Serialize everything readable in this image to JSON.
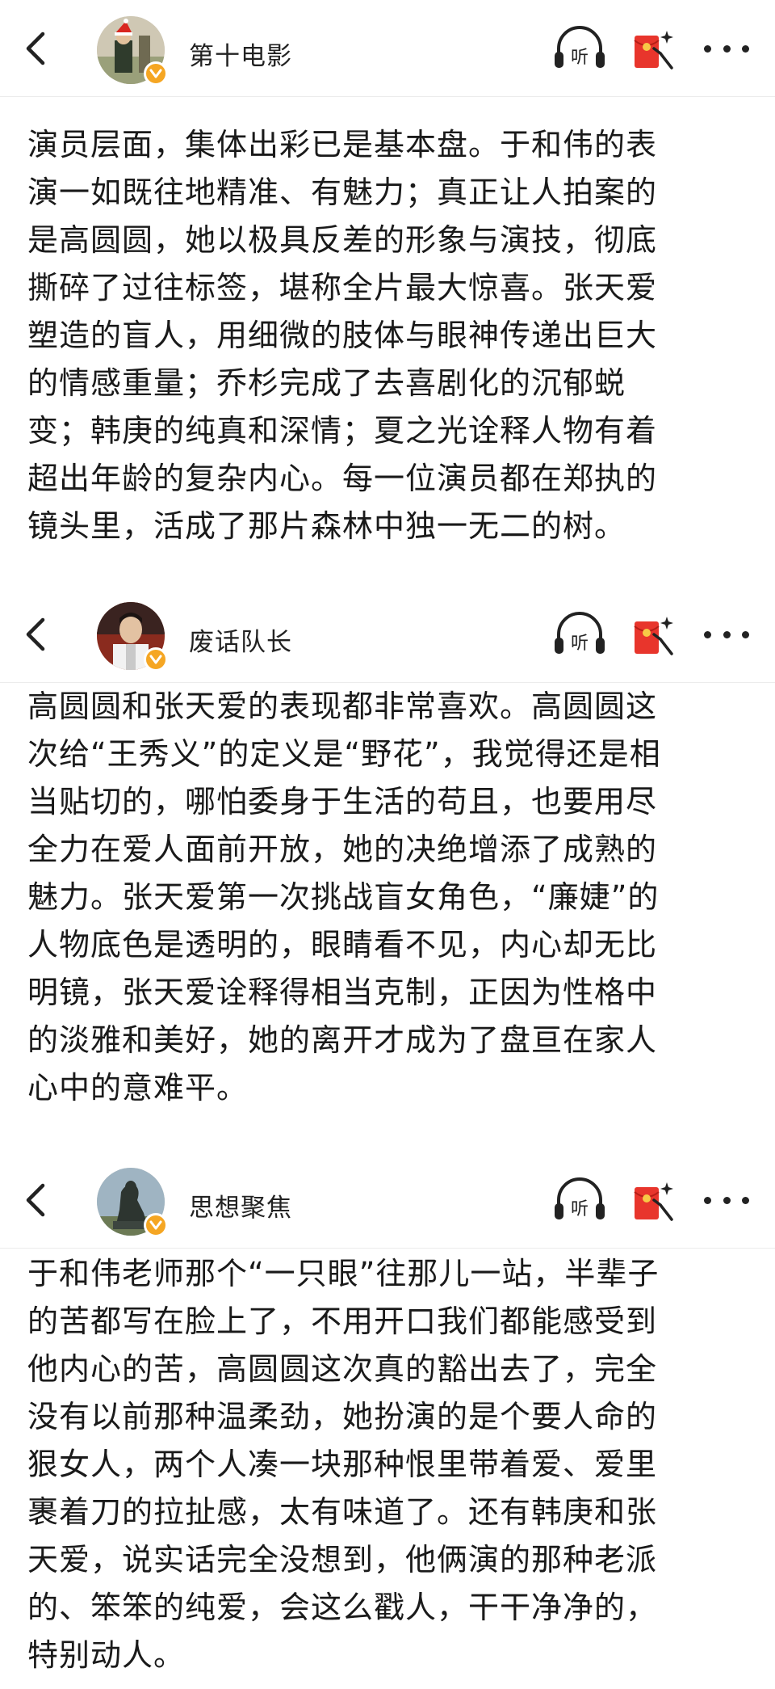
{
  "posts": [
    {
      "username": "第十电影",
      "avatar": "avatar-santa-hat",
      "lines": [
        "演员层面，集体出彩已是基本盘。于和伟的表",
        "演一如既往地精准、有魅力；真正让人拍案的",
        "是高圆圆，她以极具反差的形象与演技，彻底",
        "撕碎了过往标签，堪称全片最大惊喜。张天爱",
        "塑造的盲人，用细微的肢体与眼神传递出巨大",
        "的情感重量；乔杉完成了去喜剧化的沉郁蜕",
        "变；韩庚的纯真和深情；夏之光诠释人物有着",
        "超出年龄的复杂内心。每一位演员都在郑执的",
        "镜头里，活成了那片森林中独一无二的树。"
      ]
    },
    {
      "username": "废话队长",
      "avatar": "avatar-man-photo",
      "lines": [
        "高圆圆和张天爱的表现都非常喜欢。高圆圆这",
        "次给“王秀义”的定义是“野花”，我觉得还是相",
        "当贴切的，哪怕委身于生活的苟且，也要用尽",
        "全力在爱人面前开放，她的决绝增添了成熟的",
        "魅力。张天爱第一次挑战盲女角色，“廉婕”的",
        "人物底色是透明的，眼睛看不见，内心却无比",
        "明镜，张天爱诠释得相当克制，正因为性格中",
        "的淡雅和美好，她的离开才成为了盘亘在家人",
        "心中的意难平。"
      ]
    },
    {
      "username": "思想聚焦",
      "avatar": "avatar-thinker-statue",
      "lines": [
        "于和伟老师那个“一只眼”往那儿一站，半辈子",
        "的苦都写在脸上了，不用开口我们都能感受到",
        "他内心的苦，高圆圆这次真的豁出去了，完全",
        "没有以前那种温柔劲，她扮演的是个要人命的",
        "狠女人，两个人凑一块那种恨里带着爱、爱里",
        "裹着刀的拉扯感，太有味道了。还有韩庚和张",
        "天爱，说实话完全没想到，他俩演的那种老派",
        "的、笨笨的纯爱，会这么戳人，干干净净的，",
        "特别动人。"
      ]
    }
  ],
  "icons": {
    "back": "chevron-left-icon",
    "listen": "headphones-listen-icon",
    "listen_label": "听",
    "red_packet": "red-packet-icon",
    "more": "more-dots-icon",
    "verified": "verified-badge-icon"
  },
  "colors": {
    "text": "#1a1a1a",
    "verified_badge": "#f5a623",
    "red_packet": "#e8352c",
    "divider": "#ececec"
  }
}
